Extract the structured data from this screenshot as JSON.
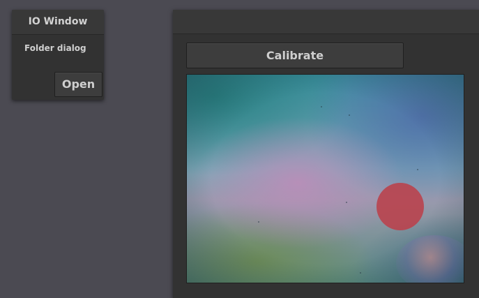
{
  "io_window": {
    "title": "IO Window",
    "folder_label": "Folder dialog",
    "open_label": "Open"
  },
  "main_panel": {
    "title": "",
    "calibrate_label": "Calibrate"
  },
  "colors": {
    "background": "#4b4a52",
    "panel": "#323232",
    "titlebar": "#383838",
    "button": "#3d3d3d",
    "text": "#cfcfcf",
    "spot": "#b8444f"
  }
}
